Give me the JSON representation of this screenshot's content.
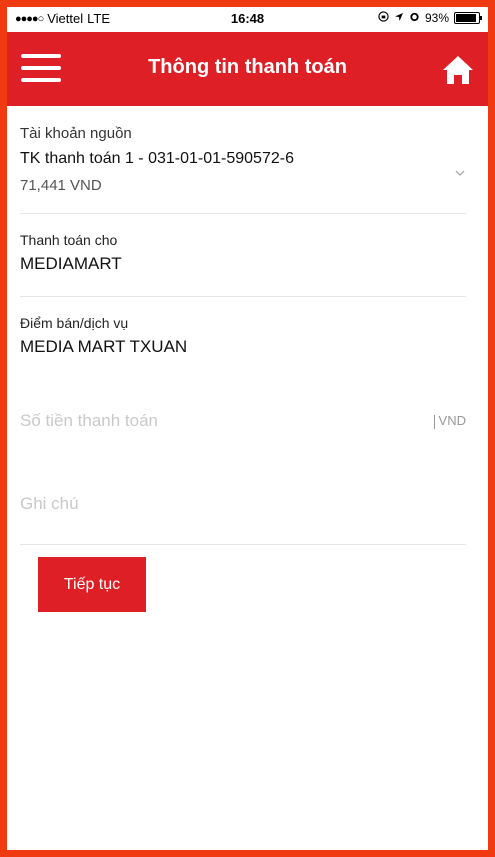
{
  "status_bar": {
    "signal_dots": "●●●●○",
    "carrier": "Viettel",
    "network": "LTE",
    "time": "16:48",
    "battery_text": "93%",
    "battery_level": 0.93
  },
  "header": {
    "title": "Thông tin thanh toán",
    "menu_icon": "hamburger-menu-icon",
    "home_icon": "home-icon",
    "accent_color": "#de1f26"
  },
  "source_account": {
    "label": "Tài khoản nguồn",
    "value": "TK thanh toán 1 - 031-01-01-590572-6",
    "balance": "71,441 VND",
    "chevron_icon": "chevron-down-icon"
  },
  "pay_to": {
    "label": "Thanh toán cho",
    "value": "MEDIAMART"
  },
  "point_of_sale": {
    "label": "Điểm bán/dịch vụ",
    "value": "MEDIA MART TXUAN"
  },
  "amount": {
    "placeholder": "Số tiền thanh toán",
    "unit": "VND"
  },
  "note": {
    "placeholder": "Ghi chú"
  },
  "actions": {
    "continue_label": "Tiếp tục"
  },
  "frame_color": "#f03a12"
}
